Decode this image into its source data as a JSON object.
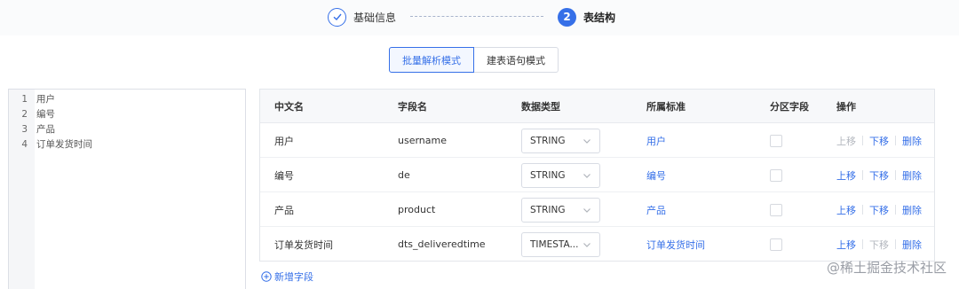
{
  "steps": [
    {
      "label": "基础信息",
      "state": "done"
    },
    {
      "label": "表结构",
      "number": "2",
      "state": "active"
    }
  ],
  "mode_toggle": {
    "batch_label": "批量解析模式",
    "sql_label": "建表语句模式",
    "active": "batch"
  },
  "editor": {
    "lines": [
      {
        "num": "1",
        "text": "用户"
      },
      {
        "num": "2",
        "text": "编号"
      },
      {
        "num": "3",
        "text": "产品"
      },
      {
        "num": "4",
        "text": "订单发货时间"
      }
    ]
  },
  "table": {
    "headers": {
      "cn_name": "中文名",
      "field_name": "字段名",
      "data_type": "数据类型",
      "standard": "所属标准",
      "partition": "分区字段",
      "actions": "操作"
    },
    "rows": [
      {
        "cn_name": "用户",
        "field_name": "username",
        "data_type": "STRING",
        "standard": "用户",
        "partition": false,
        "up": "上移",
        "up_enabled": false,
        "down": "下移",
        "down_enabled": true,
        "delete": "删除"
      },
      {
        "cn_name": "编号",
        "field_name": "de",
        "data_type": "STRING",
        "standard": "编号",
        "partition": false,
        "up": "上移",
        "up_enabled": true,
        "down": "下移",
        "down_enabled": true,
        "delete": "删除"
      },
      {
        "cn_name": "产品",
        "field_name": "product",
        "data_type": "STRING",
        "standard": "产品",
        "partition": false,
        "up": "上移",
        "up_enabled": true,
        "down": "下移",
        "down_enabled": true,
        "delete": "删除"
      },
      {
        "cn_name": "订单发货时间",
        "field_name": "dts_deliveredtime",
        "data_type": "TIMESTA...",
        "standard": "订单发货时间",
        "partition": false,
        "up": "上移",
        "up_enabled": true,
        "down": "下移",
        "down_enabled": false,
        "delete": "删除"
      }
    ]
  },
  "add_field_label": "新增字段",
  "watermark": "@稀土掘金技术社区",
  "colors": {
    "accent": "#3670e8",
    "disabled": "#b4b8bf"
  }
}
